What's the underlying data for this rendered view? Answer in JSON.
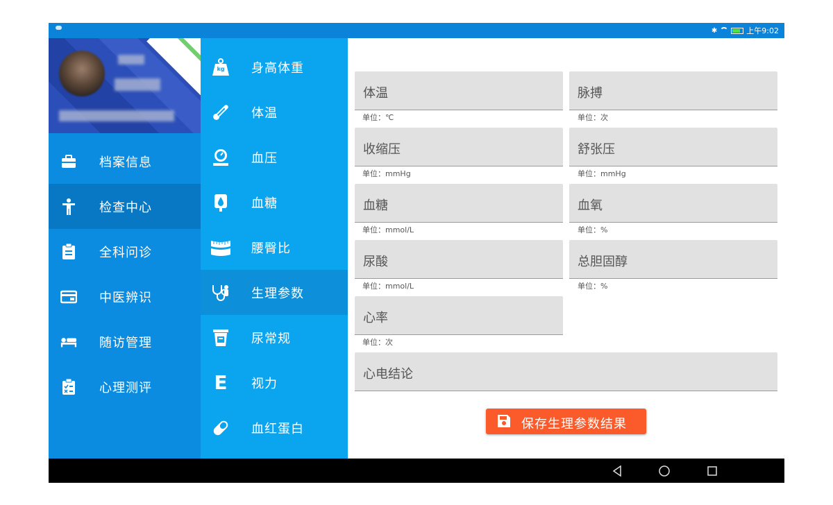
{
  "status_bar": {
    "time": "上午9:02"
  },
  "nav1": {
    "items": [
      {
        "label": "档案信息",
        "icon": "briefcase-icon"
      },
      {
        "label": "检查中心",
        "icon": "person-icon",
        "active": true
      },
      {
        "label": "全科问诊",
        "icon": "clipboard-icon"
      },
      {
        "label": "中医辨识",
        "icon": "id-card-icon"
      },
      {
        "label": "随访管理",
        "icon": "bed-icon"
      },
      {
        "label": "心理测评",
        "icon": "checklist-icon"
      }
    ]
  },
  "nav2": {
    "items": [
      {
        "label": "身高体重",
        "icon": "weight-icon",
        "icon_text": "kg"
      },
      {
        "label": "体温",
        "icon": "thermometer-icon"
      },
      {
        "label": "血压",
        "icon": "gauge-icon"
      },
      {
        "label": "血糖",
        "icon": "blood-drop-icon"
      },
      {
        "label": "腰臀比",
        "icon": "tape-measure-icon"
      },
      {
        "label": "生理参数",
        "icon": "stethoscope-icon",
        "active": true
      },
      {
        "label": "尿常规",
        "icon": "cup-icon"
      },
      {
        "label": "视力",
        "icon": "eye-chart-icon",
        "icon_text": "E"
      },
      {
        "label": "血红蛋白",
        "icon": "pill-icon"
      }
    ]
  },
  "form": {
    "fields": [
      {
        "label": "体温",
        "unit": "单位：℃"
      },
      {
        "label": "脉搏",
        "unit": "单位：次"
      },
      {
        "label": "收缩压",
        "unit": "单位：mmHg"
      },
      {
        "label": "舒张压",
        "unit": "单位：mmHg"
      },
      {
        "label": "血糖",
        "unit": "单位：mmol/L"
      },
      {
        "label": "血氧",
        "unit": "单位：%"
      },
      {
        "label": "尿酸",
        "unit": "单位：mmol/L"
      },
      {
        "label": "总胆固醇",
        "unit": "单位：%"
      },
      {
        "label": "心率",
        "unit": "单位：次"
      },
      {
        "label": "心电结论"
      }
    ],
    "save_label": "保存生理参数结果"
  },
  "colors": {
    "status_bar": "#0b83d9",
    "nav1_bg": "#0b8ce0",
    "nav1_active": "#0878c4",
    "nav2_bg": "#0ba4ee",
    "nav2_active": "#0d8fd9",
    "field_bg": "#e1e1e1",
    "save_button": "#fb5b2b"
  }
}
